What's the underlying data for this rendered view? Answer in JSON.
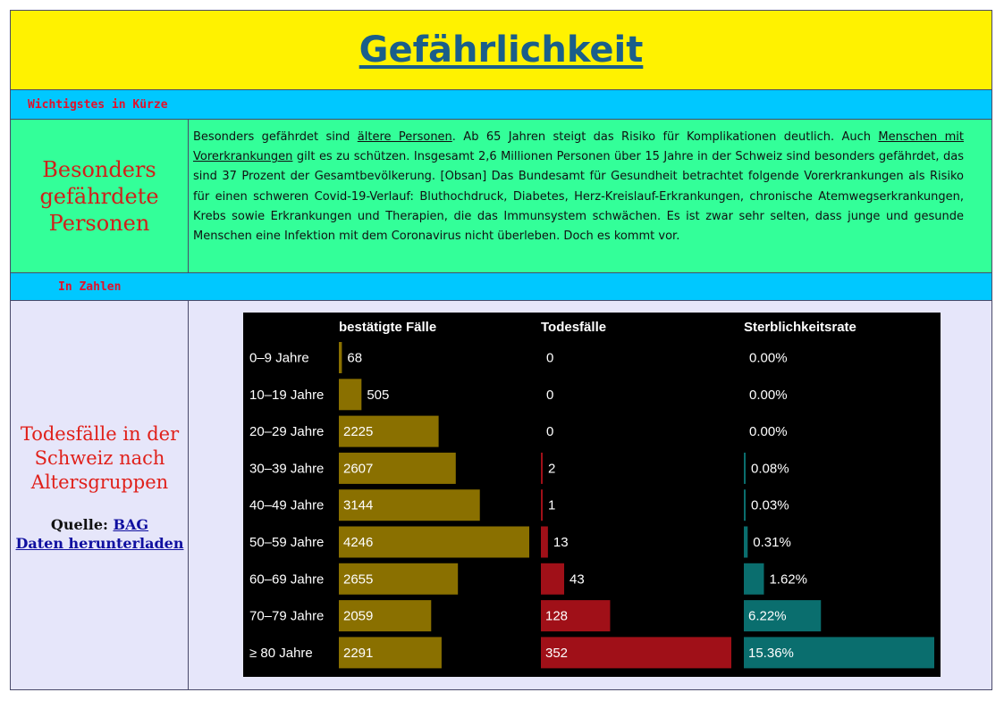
{
  "page": {
    "title": "Gefährlichkeit",
    "sections": {
      "summary_label": "Wichtigstes in Kürze",
      "numbers_label": "In Zahlen"
    }
  },
  "summary": {
    "heading": "Besonders gefährdete Personen",
    "text_parts": [
      "Besonders gefährdet sind ",
      "ältere Personen",
      ". Ab 65 Jahren steigt das Risiko für Komplikationen deutlich. Auch ",
      "Menschen mit Vorerkrankungen",
      " gilt es zu schützen. Insgesamt 2,6 Millionen Personen über 15 Jahre in der Schweiz sind besonders gefährdet, das sind 37 Prozent der Gesamtbevölkerung. [Obsan] Das Bundesamt für Gesundheit betrachtet folgende Vorerkrankungen als Risiko für einen schweren Covid-19-Verlauf: Bluthochdruck, Diabetes, Herz-Kreislauf-Erkrankungen, chronische Atemwegserkrankungen, Krebs sowie Erkrankungen und Therapien, die das Immunsystem schwächen. Es ist zwar sehr selten, dass junge und gesunde Menschen eine Infektion mit dem Coronavirus nicht überleben. Doch es kommt vor."
    ]
  },
  "numbers": {
    "heading": "Todesfälle in der Schweiz nach Altersgruppen",
    "source_label": "Quelle: ",
    "source_link": "BAG",
    "download_link": "Daten herunterladen"
  },
  "chart_data": {
    "type": "table",
    "columns": [
      "bestätigte Fälle",
      "Todesfälle",
      "Sterblichkeitsrate"
    ],
    "categories": [
      "0–9 Jahre",
      "10–19 Jahre",
      "20–29 Jahre",
      "30–39 Jahre",
      "40–49 Jahre",
      "50–59 Jahre",
      "60–69 Jahre",
      "70–79 Jahre",
      "≥ 80 Jahre"
    ],
    "series": [
      {
        "name": "bestätigte Fälle",
        "values": [
          68,
          505,
          2225,
          2607,
          3144,
          4246,
          2655,
          2059,
          2291
        ],
        "labels": [
          "68",
          "505",
          "2225",
          "2607",
          "3144",
          "4246",
          "2655",
          "2059",
          "2291"
        ],
        "color": "#8a7000"
      },
      {
        "name": "Todesfälle",
        "values": [
          0,
          0,
          0,
          2,
          1,
          13,
          43,
          128,
          352
        ],
        "labels": [
          "0",
          "0",
          "0",
          "2",
          "1",
          "13",
          "43",
          "128",
          "352"
        ],
        "color": "#a01018"
      },
      {
        "name": "Sterblichkeitsrate",
        "values": [
          0.0,
          0.0,
          0.0,
          0.08,
          0.03,
          0.31,
          1.62,
          6.22,
          15.36
        ],
        "labels": [
          "0.00%",
          "0.00%",
          "0.00%",
          "0.08%",
          "0.03%",
          "0.31%",
          "1.62%",
          "6.22%",
          "15.36%"
        ],
        "color": "#0a6e6e"
      }
    ],
    "background": "#000000",
    "text_color": "#ffffff"
  }
}
